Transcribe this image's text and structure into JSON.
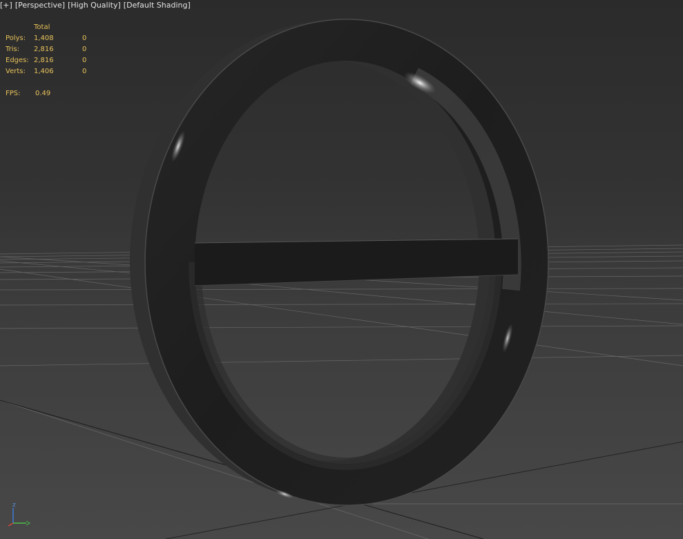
{
  "viewport": {
    "labels": [
      "[+]",
      "[Perspective]",
      "[High Quality]",
      "[Default Shading]"
    ]
  },
  "stats": {
    "header": "Total",
    "rows": [
      {
        "label": "Polys:",
        "total": "1,408",
        "selected": "0"
      },
      {
        "label": "Tris:",
        "total": "2,816",
        "selected": "0"
      },
      {
        "label": "Edges:",
        "total": "2,816",
        "selected": "0"
      },
      {
        "label": "Verts:",
        "total": "1,406",
        "selected": "0"
      }
    ],
    "fps_label": "FPS:",
    "fps_value": "0.49"
  },
  "gizmo": {
    "z_label": "z",
    "icon": "axis-gizmo-icon",
    "colors": {
      "x": "#d9443a",
      "y": "#4fbf4a",
      "z": "#3b7bd9"
    }
  },
  "colors": {
    "viewport_background": "#383838",
    "stats_text": "#e8c25a",
    "label_text": "#e6e6e6",
    "object": "#1c1c1c"
  }
}
